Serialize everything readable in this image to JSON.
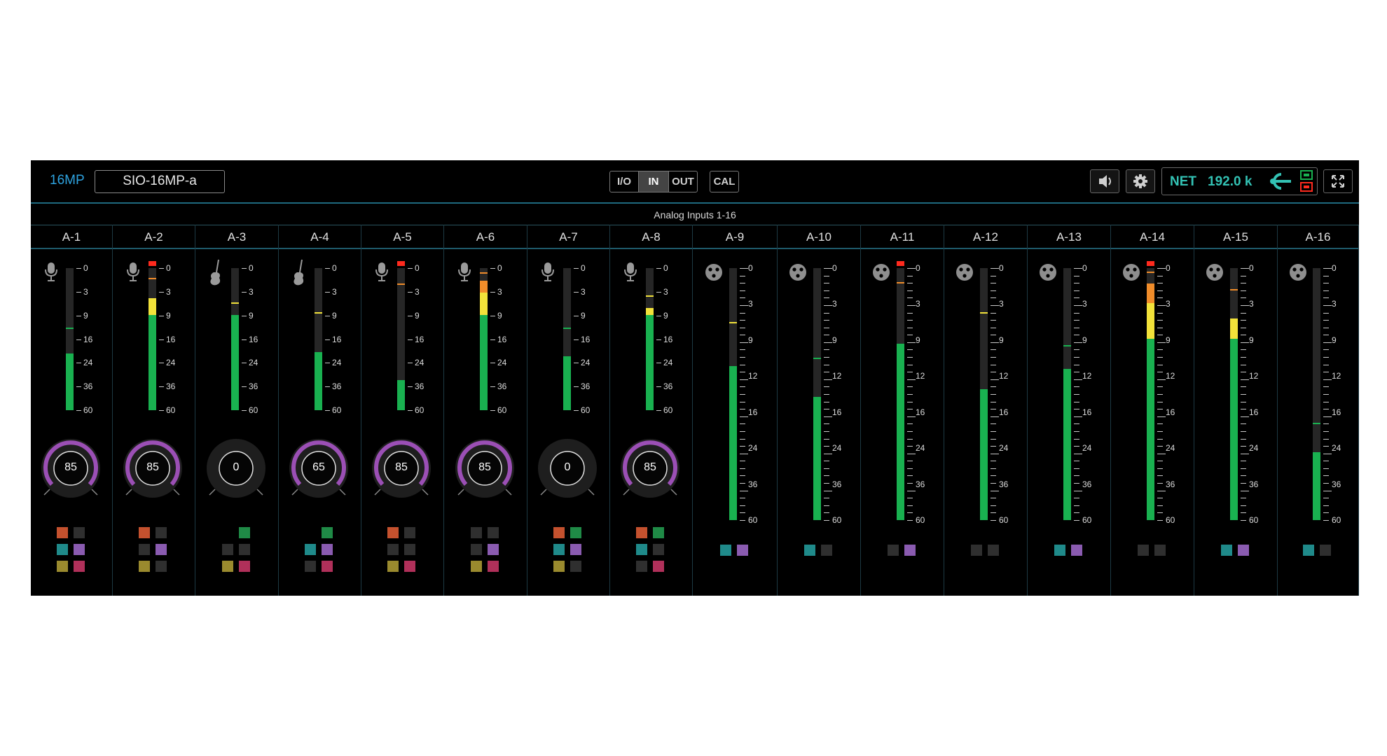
{
  "toolbar": {
    "model": "16MP",
    "device_name": "SIO-16MP-a",
    "io_label": "I/O",
    "in_label": "IN",
    "out_label": "OUT",
    "cal_label": "CAL",
    "net_label": "NET",
    "sample_rate": "192.0 k"
  },
  "group_title": "Analog Inputs 1-16",
  "colors": {
    "accent": "#2ea3e0",
    "net": "#33c2b4",
    "meter_green": "#19b150",
    "meter_yellow": "#f2e23a",
    "meter_orange": "#f08c2a",
    "clip_red": "#ff2a1e",
    "knob_arc": "#9b4fb5"
  },
  "scale_short": [
    "0",
    "3",
    "9",
    "16",
    "24",
    "36",
    "60"
  ],
  "scale_long": [
    "0",
    "3",
    "9",
    "12",
    "16",
    "24",
    "36",
    "60"
  ],
  "channels": [
    {
      "name": "A-1",
      "icon": "mic",
      "meter": "short",
      "level": 0.4,
      "yellow": 0,
      "orange": 0,
      "peak": 0.57,
      "peak_color": "green",
      "clip": false,
      "gain": "85",
      "gain_active": true,
      "buttons": [
        [
          "orange",
          "dark"
        ],
        [
          "teal",
          "purple"
        ],
        [
          "olive",
          "magenta"
        ]
      ]
    },
    {
      "name": "A-2",
      "icon": "mic",
      "meter": "short",
      "level": 0.67,
      "yellow": 0.12,
      "orange": 0,
      "peak": 0.92,
      "peak_color": "orange",
      "clip": true,
      "gain": "85",
      "gain_active": true,
      "buttons": [
        [
          "orange",
          "dark"
        ],
        [
          "dark",
          "purple"
        ],
        [
          "olive",
          "dark"
        ]
      ]
    },
    {
      "name": "A-3",
      "icon": "guitar",
      "meter": "short",
      "level": 0.67,
      "yellow": 0,
      "orange": 0,
      "peak": 0.75,
      "peak_color": "yellow",
      "clip": false,
      "gain": "0",
      "gain_active": false,
      "buttons": [
        [
          "none",
          "green"
        ],
        [
          "dark",
          "dark"
        ],
        [
          "olive",
          "magenta"
        ]
      ]
    },
    {
      "name": "A-4",
      "icon": "guitar",
      "meter": "short",
      "level": 0.41,
      "yellow": 0,
      "orange": 0,
      "peak": 0.68,
      "peak_color": "yellow",
      "clip": false,
      "gain": "65",
      "gain_active": true,
      "buttons": [
        [
          "none",
          "green"
        ],
        [
          "teal",
          "purple"
        ],
        [
          "dark",
          "magenta"
        ]
      ]
    },
    {
      "name": "A-5",
      "icon": "mic",
      "meter": "short",
      "level": 0.21,
      "yellow": 0,
      "orange": 0,
      "peak": 0.88,
      "peak_color": "orange",
      "clip": true,
      "gain": "85",
      "gain_active": true,
      "buttons": [
        [
          "orange",
          "dark"
        ],
        [
          "dark",
          "dark"
        ],
        [
          "olive",
          "magenta"
        ]
      ]
    },
    {
      "name": "A-6",
      "icon": "mic",
      "meter": "short",
      "level": 0.67,
      "yellow": 0.16,
      "orange": 0.08,
      "peak": 0.96,
      "peak_color": "orange",
      "clip": false,
      "gain": "85",
      "gain_active": true,
      "buttons": [
        [
          "dark",
          "dark"
        ],
        [
          "dark",
          "purple"
        ],
        [
          "olive",
          "magenta"
        ]
      ]
    },
    {
      "name": "A-7",
      "icon": "mic",
      "meter": "short",
      "level": 0.38,
      "yellow": 0,
      "orange": 0,
      "peak": 0.57,
      "peak_color": "green",
      "clip": false,
      "gain": "0",
      "gain_active": false,
      "buttons": [
        [
          "orange",
          "green"
        ],
        [
          "teal",
          "purple"
        ],
        [
          "olive",
          "dark"
        ]
      ]
    },
    {
      "name": "A-8",
      "icon": "mic",
      "meter": "short",
      "level": 0.67,
      "yellow": 0.05,
      "orange": 0,
      "peak": 0.8,
      "peak_color": "yellow",
      "clip": false,
      "gain": "85",
      "gain_active": true,
      "buttons": [
        [
          "orange",
          "green"
        ],
        [
          "teal",
          "dark"
        ],
        [
          "dark",
          "magenta"
        ]
      ]
    },
    {
      "name": "A-9",
      "icon": "xlr",
      "meter": "long",
      "level": 0.61,
      "yellow": 0,
      "orange": 0,
      "peak": 0.78,
      "peak_color": "yellow",
      "clip": false,
      "buttons": [
        [
          "teal",
          "purple"
        ]
      ]
    },
    {
      "name": "A-10",
      "icon": "xlr",
      "meter": "long",
      "level": 0.49,
      "yellow": 0,
      "orange": 0,
      "peak": 0.64,
      "peak_color": "green",
      "clip": false,
      "buttons": [
        [
          "teal",
          "dark"
        ]
      ]
    },
    {
      "name": "A-11",
      "icon": "xlr",
      "meter": "long",
      "level": 0.7,
      "yellow": 0,
      "orange": 0,
      "peak": 0.94,
      "peak_color": "orange",
      "clip": true,
      "buttons": [
        [
          "dark",
          "purple"
        ]
      ]
    },
    {
      "name": "A-12",
      "icon": "xlr",
      "meter": "long",
      "level": 0.52,
      "yellow": 0,
      "orange": 0,
      "peak": 0.82,
      "peak_color": "yellow",
      "clip": false,
      "buttons": [
        [
          "dark",
          "dark"
        ]
      ]
    },
    {
      "name": "A-13",
      "icon": "xlr",
      "meter": "long",
      "level": 0.6,
      "yellow": 0,
      "orange": 0,
      "peak": 0.69,
      "peak_color": "green",
      "clip": false,
      "buttons": [
        [
          "teal",
          "purple"
        ]
      ]
    },
    {
      "name": "A-14",
      "icon": "xlr",
      "meter": "long",
      "level": 0.72,
      "yellow": 0.14,
      "orange": 0.08,
      "peak": 0.98,
      "peak_color": "orange",
      "clip": true,
      "buttons": [
        [
          "dark",
          "dark"
        ]
      ]
    },
    {
      "name": "A-15",
      "icon": "xlr",
      "meter": "long",
      "level": 0.72,
      "yellow": 0.08,
      "orange": 0,
      "peak": 0.91,
      "peak_color": "orange",
      "clip": false,
      "buttons": [
        [
          "teal",
          "purple"
        ]
      ]
    },
    {
      "name": "A-16",
      "icon": "xlr",
      "meter": "long",
      "level": 0.27,
      "yellow": 0,
      "orange": 0,
      "peak": 0.38,
      "peak_color": "green",
      "clip": false,
      "buttons": [
        [
          "teal",
          "dark"
        ]
      ]
    }
  ]
}
